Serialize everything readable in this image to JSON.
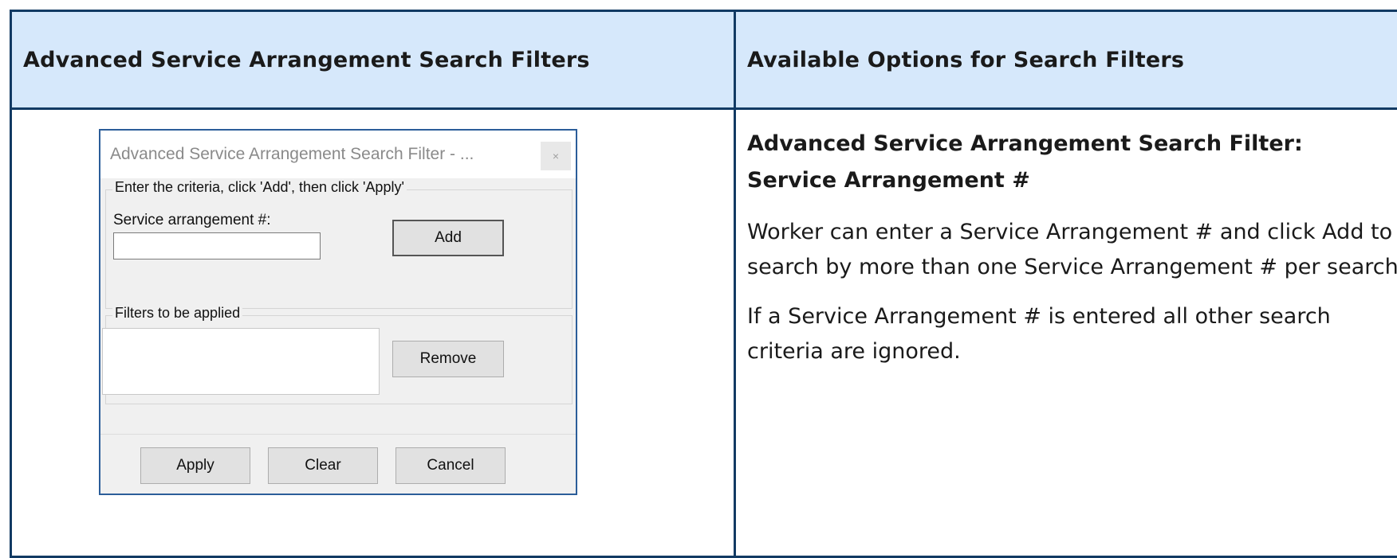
{
  "table": {
    "header_left": "Advanced Service Arrangement Search Filters",
    "header_right": "Available Options for Search Filters"
  },
  "dialog": {
    "title": "Advanced Service Arrangement Search Filter - ...",
    "close_label": "×",
    "criteria_group_label": "Enter the criteria, click 'Add', then click 'Apply'",
    "service_arrangement_label": "Service arrangement #:",
    "service_arrangement_value": "",
    "add_button": "Add",
    "filters_group_label": "Filters to be applied",
    "remove_button": "Remove",
    "apply_button": "Apply",
    "clear_button": "Clear",
    "cancel_button": "Cancel"
  },
  "options": {
    "title_line1": "Advanced Service Arrangement Search Filter:",
    "title_line2": "Service Arrangement #",
    "paragraph1": "Worker can enter a Service Arrangement # and click Add to search by more than one Service Arrangement # per search.",
    "paragraph2": "If a Service Arrangement # is entered all other search criteria are ignored."
  }
}
